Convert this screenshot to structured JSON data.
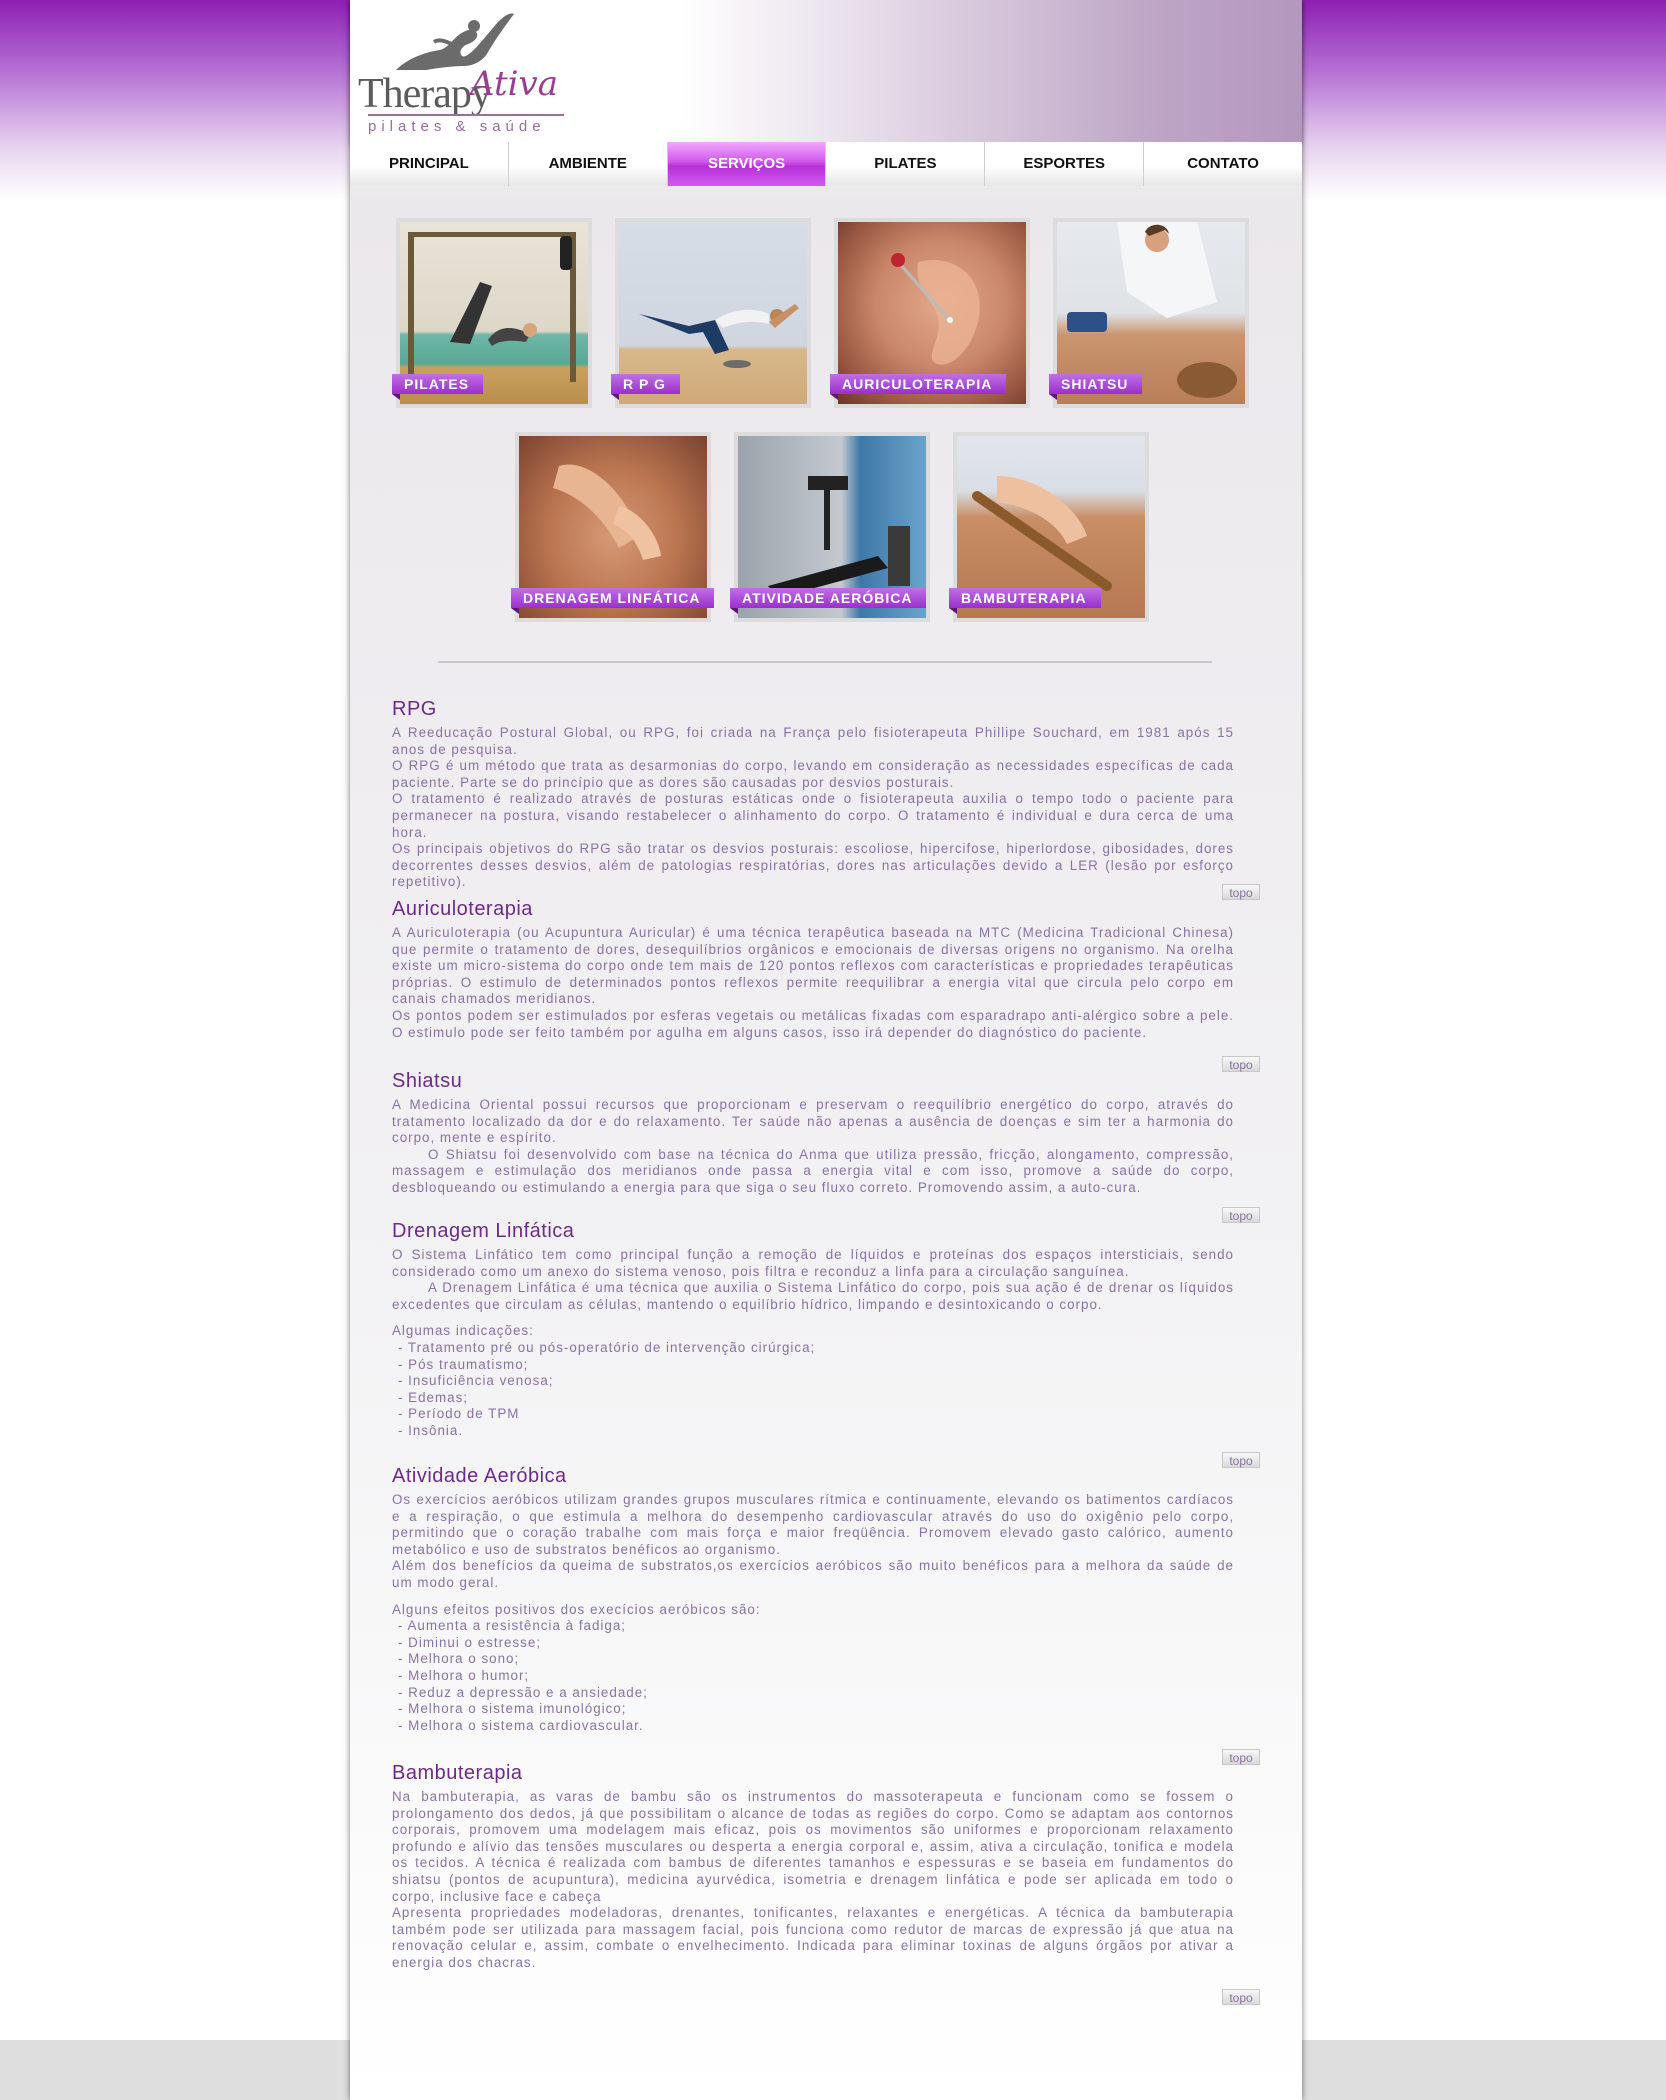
{
  "brand": {
    "name_part1": "Therapy",
    "name_part2": "Ativa",
    "tagline": "pilates & saúde"
  },
  "nav": {
    "items": [
      {
        "label": "PRINCIPAL"
      },
      {
        "label": "AMBIENTE"
      },
      {
        "label": "SERVIÇOS",
        "active": true
      },
      {
        "label": "PILATES"
      },
      {
        "label": "ESPORTES"
      },
      {
        "label": "CONTATO"
      }
    ]
  },
  "gallery": [
    {
      "label": "PILATES"
    },
    {
      "label": "R P G"
    },
    {
      "label": "AURICULOTERAPIA"
    },
    {
      "label": "SHIATSU"
    },
    {
      "label": "DRENAGEM LINFÁTICA"
    },
    {
      "label": "ATIVIDADE AERÓBICA"
    },
    {
      "label": "BAMBUTERAPIA"
    }
  ],
  "topo_label": "topo",
  "sections": {
    "rpg": {
      "title": "RPG",
      "paragraphs": [
        "A Reeducação Postural Global, ou RPG, foi criada na França pelo fisioterapeuta Phillipe Souchard, em 1981 após 15 anos de pesquisa.",
        "O RPG é um método que trata as desarmonias do corpo, levando em consideração as necessidades específicas de cada paciente. Parte se do princípio que as dores são causadas por desvios posturais.",
        "O tratamento é realizado através de posturas estáticas onde o fisioterapeuta auxilia o tempo todo o paciente para permanecer na postura, visando restabelecer o alinhamento do corpo. O tratamento é individual e dura cerca de uma hora.",
        "Os principais objetivos do RPG são tratar os desvios posturais: escoliose, hipercifose, hiperlordose, gibosidades, dores decorrentes desses desvios, além de patologias respiratórias, dores nas articulações devido a LER (lesão por esforço repetitivo)."
      ]
    },
    "auriculo": {
      "title": "Auriculoterapia",
      "paragraphs": [
        "A Auriculoterapia (ou Acupuntura Auricular) é uma técnica terapêutica baseada na MTC (Medicina Tradicional Chinesa) que permite o tratamento de dores, desequilíbrios orgânicos e emocionais de diversas origens no organismo. Na orelha existe um micro-sistema do corpo onde tem mais de 120 pontos reflexos com características e propriedades terapêuticas próprias. O estimulo de determinados pontos reflexos permite reequilibrar a energia vital que circula pelo corpo em canais chamados meridianos.",
        "Os pontos podem ser estimulados por esferas vegetais ou metálicas fixadas com esparadrapo anti-alérgico sobre a pele. O estimulo pode ser feito também por agulha em alguns casos, isso irá depender do diagnóstico do paciente."
      ]
    },
    "shiatsu": {
      "title": "Shiatsu",
      "paragraphs": [
        "A Medicina Oriental possui recursos que proporcionam e preservam o reequilíbrio energético do corpo, através do tratamento localizado da dor e do relaxamento. Ter saúde não apenas a ausência de doenças e sim ter a harmonia do corpo, mente e espírito.",
        "O Shiatsu foi desenvolvido com base na técnica do Anma que utiliza pressão, fricção, alongamento, compressão, massagem e estimulação dos meridianos onde passa a energia vital e com isso, promove a saúde do corpo, desbloqueando ou estimulando a energia para que siga o seu fluxo correto. Promovendo assim, a auto-cura."
      ]
    },
    "drenagem": {
      "title": "Drenagem Linfática",
      "paragraphs": [
        "O Sistema Linfático tem como principal função a remoção de líquidos e proteínas dos espaços intersticiais, sendo considerado como um anexo do sistema venoso, pois filtra e reconduz a linfa para a circulação sanguínea.",
        "A Drenagem Linfática é uma técnica que auxilia o Sistema Linfático do corpo, pois sua ação é de drenar os líquidos excedentes que circulam as células, mantendo o equilíbrio hídrico, limpando e desintoxicando o corpo."
      ],
      "list_title": "Algumas indicações:",
      "items": [
        "- Tratamento pré ou pós-operatório de intervenção cirúrgica;",
        "- Pós traumatismo;",
        "- Insuficiência venosa;",
        "- Edemas;",
        "- Período de TPM",
        "- Insônia."
      ]
    },
    "aerobica": {
      "title": "Atividade Aeróbica",
      "paragraphs": [
        "Os exercícios aeróbicos utilizam grandes grupos musculares rítmica e continuamente, elevando os batimentos cardíacos e a respiração, o que estimula a melhora do desempenho cardiovascular através do uso do oxigênio pelo corpo, permitindo que o coração trabalhe com mais força e maior freqüência. Promovem elevado gasto calórico, aumento metabólico e uso de substratos benéficos ao organismo.",
        "Além dos benefícios da queima de substratos,os exercícios aeróbicos são muito benéficos para a melhora da saúde de um modo geral."
      ],
      "list_title": "Alguns efeitos positivos dos execícios aeróbicos são:",
      "items": [
        "- Aumenta a resistência à fadiga;",
        "- Diminui o estresse;",
        "- Melhora o sono;",
        "- Melhora o humor;",
        "- Reduz a depressão e a ansiedade;",
        "- Melhora o sistema imunológico;",
        "- Melhora o sistema cardiovascular."
      ]
    },
    "bambu": {
      "title": "Bambuterapia",
      "paragraphs": [
        "Na bambuterapia, as varas de bambu são os instrumentos do massoterapeuta e funcionam como se fossem o prolongamento dos dedos, já que possibilitam o alcance de todas as regiões do corpo. Como se adaptam aos contornos corporais, promovem uma modelagem mais eficaz, pois os movimentos são uniformes e proporcionam relaxamento profundo e alívio das tensões musculares ou desperta a energia corporal e, assim, ativa a circulação, tonifica e modela os tecidos. A técnica é realizada com bambus de diferentes tamanhos e espessuras e se baseia em fundamentos do shiatsu (pontos de acupuntura), medicina ayurvédica, isometria e drenagem linfática e pode ser aplicada em todo o corpo, inclusive face e cabeça",
        "Apresenta propriedades modeladoras, drenantes, tonificantes, relaxantes e energéticas. A técnica da bambuterapia também pode ser utilizada para massagem facial, pois funciona como redutor de marcas de expressão já que atua na renovação celular e, assim, combate o envelhecimento. Indicada para eliminar toxinas de alguns órgãos por ativar a energia dos chacras."
      ]
    }
  }
}
